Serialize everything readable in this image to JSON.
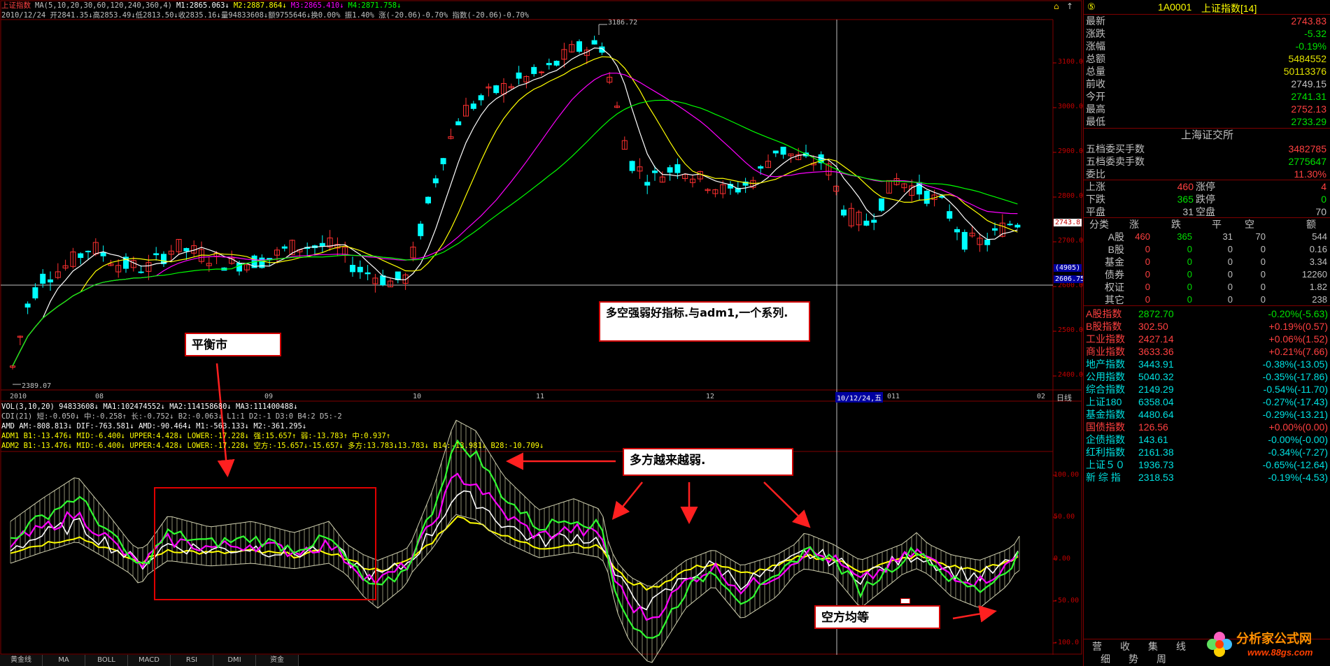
{
  "window": {
    "instrument_name": "上证指数",
    "ma_legend": {
      "head": "MA(5,10,20,30,60,120,240,360,4)",
      "m1": "M1:2865.063↓",
      "m2": "M2:2887.864↓",
      "m3": "M3:2865.410↓",
      "m4": "M4:2871.758↓"
    },
    "quote_line": "2010/12/24 开2841.35↓高2853.49↓低2813.50↓收2835.16↓量94833608↓额9755646↓换0.00% 振1.40% 涨(-20.06)-0.70% 指数(-20.06)-0.70%",
    "high_label": "3186.72",
    "low_label": "2389.07",
    "lock_icon": "lock-icon",
    "price_axis": [
      "3100.0",
      "3000.0",
      "2900.0",
      "2800.0",
      "2700.0",
      "2600.0",
      "2500.0",
      "2400.0"
    ],
    "current_price_tag": "2743.8",
    "crosshair_price_tag": "2606.75",
    "crosshair_vol_tag": "(4905)",
    "date_axis": [
      {
        "label": "2010"
      },
      {
        "label": "08"
      },
      {
        "label": "09"
      },
      {
        "label": "10"
      },
      {
        "label": "11"
      },
      {
        "label": "12"
      },
      {
        "label": "011"
      },
      {
        "label": "02"
      }
    ],
    "crosshair_date": "10/12/24,五",
    "period_label": "日线",
    "indicator_lines": [
      {
        "text": "VOL(3,10,20) 94833608↓ MA1:102474552↓ MA2:114158680↓ MA3:111400488↓"
      },
      {
        "text": "CDI(21) 短:-0.050↓ 中:-0.258↑ 长:-0.752↓ B2:-0.063↓ L1:1 D2:-1 D3:0 B4:2 D5:-2"
      },
      {
        "text": "AMD AM:-808.813↓ DIF:-763.581↓ AMD:-90.464↓ M1:-563.133↓ M2:-361.295↓"
      },
      {
        "text": "ADM1 B1:-13.476↓ MID:-6.400↓ UPPER:4.428↓ LOWER:-17.228↓ 强:15.657↑ 弱:-13.783↑ 中:0.937↑"
      },
      {
        "text": "ADM2 B1:-13.476↓ MID:-6.400↓ UPPER:4.428↓ LOWER:-17.228↓ 空方:-15.657↓-15.657↓ 多方:13.783↓13.783↓ B14:-13.981↓ B28:-10.709↓"
      }
    ],
    "osc_axis": [
      "100.00",
      "50.00",
      "0.00",
      "-50.00",
      "-100.0"
    ],
    "bottom_tabs": [
      "黄金线",
      "MA",
      "BOLL",
      "MACD",
      "RSI",
      "DMI",
      "资金"
    ]
  },
  "annotations": {
    "main_note": "多空强弱好指标.与adm1,一个系列.",
    "balance": "平衡市",
    "bulls_weaker": "多方越来越弱.",
    "equal": "空方均等"
  },
  "panel": {
    "header_code": "1A0001",
    "header_name": "上证指数[14]",
    "header_num": "⑤",
    "quotes": [
      {
        "k": "最新",
        "v": "2743.83",
        "color": "#ff4040"
      },
      {
        "k": "涨跌",
        "v": "-5.32",
        "color": "#00e000"
      },
      {
        "k": "涨幅",
        "v": "-0.19%",
        "color": "#00e000"
      },
      {
        "k": "总额",
        "v": "5484552",
        "color": "#e0e000"
      },
      {
        "k": "总量",
        "v": "50113376",
        "color": "#e0e000"
      },
      {
        "k": "前收",
        "v": "2749.15",
        "color": "#c0c0c0"
      },
      {
        "k": "今开",
        "v": "2741.31",
        "color": "#00e000"
      },
      {
        "k": "最高",
        "v": "2752.13",
        "color": "#ff4040"
      },
      {
        "k": "最低",
        "v": "2733.29",
        "color": "#00e000"
      }
    ],
    "exchange": "上海证交所",
    "orders": [
      {
        "k": "五档委买手数",
        "v": "3482785",
        "color": "#ff4040"
      },
      {
        "k": "五档委卖手数",
        "v": "2775647",
        "color": "#00e000"
      },
      {
        "k": "委比",
        "v": "11.30%",
        "color": "#ff4040"
      }
    ],
    "breadth": [
      {
        "k1": "上涨",
        "v1": "460",
        "c1": "#ff4040",
        "k2": "涨停",
        "v2": "4",
        "c2": "#ff4040"
      },
      {
        "k1": "下跌",
        "v1": "365",
        "c1": "#00e000",
        "k2": "跌停",
        "v2": "0",
        "c2": "#00e000"
      },
      {
        "k1": "平盘",
        "v1": "31",
        "c1": "#c0c0c0",
        "k2": "空盘",
        "v2": "70",
        "c2": "#c0c0c0"
      }
    ],
    "table_headers": [
      "分类",
      "涨",
      "跌",
      "平",
      "空",
      "额"
    ],
    "table_rows": [
      {
        "name": "A股",
        "cells": [
          "460",
          "365",
          "31",
          "70",
          "544"
        ]
      },
      {
        "name": "B股",
        "cells": [
          "0",
          "0",
          "0",
          "0",
          "0.16"
        ]
      },
      {
        "name": "基金",
        "cells": [
          "0",
          "0",
          "0",
          "0",
          "3.34"
        ]
      },
      {
        "name": "债券",
        "cells": [
          "0",
          "0",
          "0",
          "0",
          "12260"
        ]
      },
      {
        "name": "权证",
        "cells": [
          "0",
          "0",
          "0",
          "0",
          "1.82"
        ]
      },
      {
        "name": "其它",
        "cells": [
          "0",
          "0",
          "0",
          "0",
          "238"
        ]
      }
    ],
    "indices": [
      {
        "name": "A股指数",
        "price": "2872.70",
        "chg": "-0.20%(-5.63)",
        "nc": "#ff4040",
        "pc": "#00e000",
        "cc": "#00e000"
      },
      {
        "name": "B股指数",
        "price": "302.50",
        "chg": "+0.19%(0.57)",
        "nc": "#ff4040",
        "pc": "#ff4040",
        "cc": "#ff4040"
      },
      {
        "name": "工业指数",
        "price": "2427.14",
        "chg": "+0.06%(1.52)",
        "nc": "#ff4040",
        "pc": "#ff4040",
        "cc": "#ff4040"
      },
      {
        "name": "商业指数",
        "price": "3633.36",
        "chg": "+0.21%(7.66)",
        "nc": "#ff4040",
        "pc": "#ff4040",
        "cc": "#ff4040"
      },
      {
        "name": "地产指数",
        "price": "3443.91",
        "chg": "-0.38%(-13.05)",
        "nc": "#00e0e0",
        "pc": "#00e0e0",
        "cc": "#00e0e0"
      },
      {
        "name": "公用指数",
        "price": "5040.32",
        "chg": "-0.35%(-17.86)",
        "nc": "#00e0e0",
        "pc": "#00e0e0",
        "cc": "#00e0e0"
      },
      {
        "name": "综合指数",
        "price": "2149.29",
        "chg": "-0.54%(-11.70)",
        "nc": "#00e0e0",
        "pc": "#00e0e0",
        "cc": "#00e0e0"
      },
      {
        "name": "上证180",
        "price": "6358.04",
        "chg": "-0.27%(-17.43)",
        "nc": "#00e0e0",
        "pc": "#00e0e0",
        "cc": "#00e0e0"
      },
      {
        "name": "基金指数",
        "price": "4480.64",
        "chg": "-0.29%(-13.21)",
        "nc": "#00e0e0",
        "pc": "#00e0e0",
        "cc": "#00e0e0"
      },
      {
        "name": "国债指数",
        "price": "126.56",
        "chg": "+0.00%(0.00)",
        "nc": "#ff4040",
        "pc": "#ff4040",
        "cc": "#ff4040"
      },
      {
        "name": "企债指数",
        "price": "143.61",
        "chg": "-0.00%(-0.00)",
        "nc": "#00e0e0",
        "pc": "#00e0e0",
        "cc": "#00e0e0"
      },
      {
        "name": "红利指数",
        "price": "2161.38",
        "chg": "-0.34%(-7.27)",
        "nc": "#00e0e0",
        "pc": "#00e0e0",
        "cc": "#00e0e0"
      },
      {
        "name": "上证５０",
        "price": "1936.73",
        "chg": "-0.65%(-12.64)",
        "nc": "#00e0e0",
        "pc": "#00e0e0",
        "cc": "#00e0e0"
      },
      {
        "name": "新 综 指",
        "price": "2318.53",
        "chg": "-0.19%(-4.53)",
        "nc": "#00e0e0",
        "pc": "#00e0e0",
        "cc": "#00e0e0"
      }
    ],
    "bottom_tabs_row1": [
      "营",
      "收",
      "集",
      "线"
    ],
    "bottom_tabs_row2": [
      "细",
      "势",
      "周"
    ],
    "logo_text": "分析家公式网",
    "logo_url": "www.88gs.com"
  }
}
